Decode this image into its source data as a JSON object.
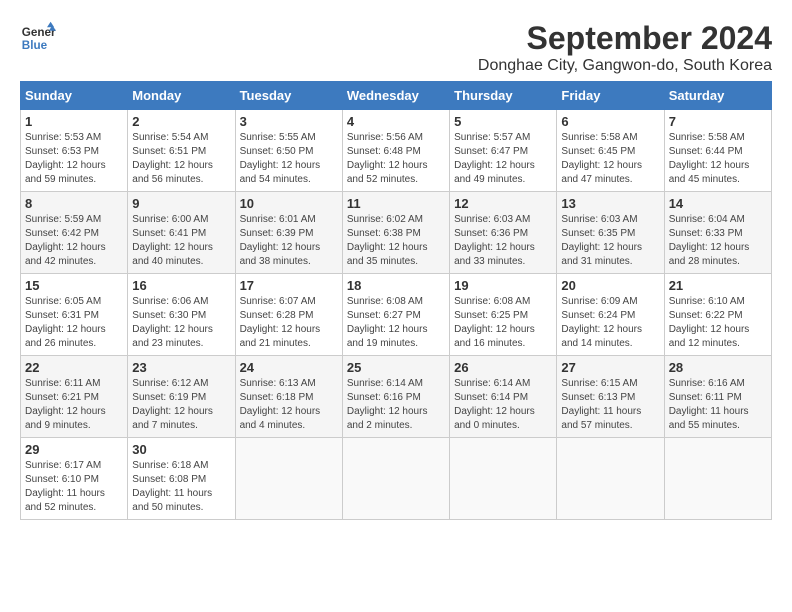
{
  "header": {
    "logo_line1": "General",
    "logo_line2": "Blue",
    "month_title": "September 2024",
    "location": "Donghae City, Gangwon-do, South Korea"
  },
  "weekdays": [
    "Sunday",
    "Monday",
    "Tuesday",
    "Wednesday",
    "Thursday",
    "Friday",
    "Saturday"
  ],
  "weeks": [
    [
      {
        "day": "1",
        "info": "Sunrise: 5:53 AM\nSunset: 6:53 PM\nDaylight: 12 hours\nand 59 minutes."
      },
      {
        "day": "2",
        "info": "Sunrise: 5:54 AM\nSunset: 6:51 PM\nDaylight: 12 hours\nand 56 minutes."
      },
      {
        "day": "3",
        "info": "Sunrise: 5:55 AM\nSunset: 6:50 PM\nDaylight: 12 hours\nand 54 minutes."
      },
      {
        "day": "4",
        "info": "Sunrise: 5:56 AM\nSunset: 6:48 PM\nDaylight: 12 hours\nand 52 minutes."
      },
      {
        "day": "5",
        "info": "Sunrise: 5:57 AM\nSunset: 6:47 PM\nDaylight: 12 hours\nand 49 minutes."
      },
      {
        "day": "6",
        "info": "Sunrise: 5:58 AM\nSunset: 6:45 PM\nDaylight: 12 hours\nand 47 minutes."
      },
      {
        "day": "7",
        "info": "Sunrise: 5:58 AM\nSunset: 6:44 PM\nDaylight: 12 hours\nand 45 minutes."
      }
    ],
    [
      {
        "day": "8",
        "info": "Sunrise: 5:59 AM\nSunset: 6:42 PM\nDaylight: 12 hours\nand 42 minutes."
      },
      {
        "day": "9",
        "info": "Sunrise: 6:00 AM\nSunset: 6:41 PM\nDaylight: 12 hours\nand 40 minutes."
      },
      {
        "day": "10",
        "info": "Sunrise: 6:01 AM\nSunset: 6:39 PM\nDaylight: 12 hours\nand 38 minutes."
      },
      {
        "day": "11",
        "info": "Sunrise: 6:02 AM\nSunset: 6:38 PM\nDaylight: 12 hours\nand 35 minutes."
      },
      {
        "day": "12",
        "info": "Sunrise: 6:03 AM\nSunset: 6:36 PM\nDaylight: 12 hours\nand 33 minutes."
      },
      {
        "day": "13",
        "info": "Sunrise: 6:03 AM\nSunset: 6:35 PM\nDaylight: 12 hours\nand 31 minutes."
      },
      {
        "day": "14",
        "info": "Sunrise: 6:04 AM\nSunset: 6:33 PM\nDaylight: 12 hours\nand 28 minutes."
      }
    ],
    [
      {
        "day": "15",
        "info": "Sunrise: 6:05 AM\nSunset: 6:31 PM\nDaylight: 12 hours\nand 26 minutes."
      },
      {
        "day": "16",
        "info": "Sunrise: 6:06 AM\nSunset: 6:30 PM\nDaylight: 12 hours\nand 23 minutes."
      },
      {
        "day": "17",
        "info": "Sunrise: 6:07 AM\nSunset: 6:28 PM\nDaylight: 12 hours\nand 21 minutes."
      },
      {
        "day": "18",
        "info": "Sunrise: 6:08 AM\nSunset: 6:27 PM\nDaylight: 12 hours\nand 19 minutes."
      },
      {
        "day": "19",
        "info": "Sunrise: 6:08 AM\nSunset: 6:25 PM\nDaylight: 12 hours\nand 16 minutes."
      },
      {
        "day": "20",
        "info": "Sunrise: 6:09 AM\nSunset: 6:24 PM\nDaylight: 12 hours\nand 14 minutes."
      },
      {
        "day": "21",
        "info": "Sunrise: 6:10 AM\nSunset: 6:22 PM\nDaylight: 12 hours\nand 12 minutes."
      }
    ],
    [
      {
        "day": "22",
        "info": "Sunrise: 6:11 AM\nSunset: 6:21 PM\nDaylight: 12 hours\nand 9 minutes."
      },
      {
        "day": "23",
        "info": "Sunrise: 6:12 AM\nSunset: 6:19 PM\nDaylight: 12 hours\nand 7 minutes."
      },
      {
        "day": "24",
        "info": "Sunrise: 6:13 AM\nSunset: 6:18 PM\nDaylight: 12 hours\nand 4 minutes."
      },
      {
        "day": "25",
        "info": "Sunrise: 6:14 AM\nSunset: 6:16 PM\nDaylight: 12 hours\nand 2 minutes."
      },
      {
        "day": "26",
        "info": "Sunrise: 6:14 AM\nSunset: 6:14 PM\nDaylight: 12 hours\nand 0 minutes."
      },
      {
        "day": "27",
        "info": "Sunrise: 6:15 AM\nSunset: 6:13 PM\nDaylight: 11 hours\nand 57 minutes."
      },
      {
        "day": "28",
        "info": "Sunrise: 6:16 AM\nSunset: 6:11 PM\nDaylight: 11 hours\nand 55 minutes."
      }
    ],
    [
      {
        "day": "29",
        "info": "Sunrise: 6:17 AM\nSunset: 6:10 PM\nDaylight: 11 hours\nand 52 minutes."
      },
      {
        "day": "30",
        "info": "Sunrise: 6:18 AM\nSunset: 6:08 PM\nDaylight: 11 hours\nand 50 minutes."
      },
      {
        "day": "",
        "info": ""
      },
      {
        "day": "",
        "info": ""
      },
      {
        "day": "",
        "info": ""
      },
      {
        "day": "",
        "info": ""
      },
      {
        "day": "",
        "info": ""
      }
    ]
  ]
}
